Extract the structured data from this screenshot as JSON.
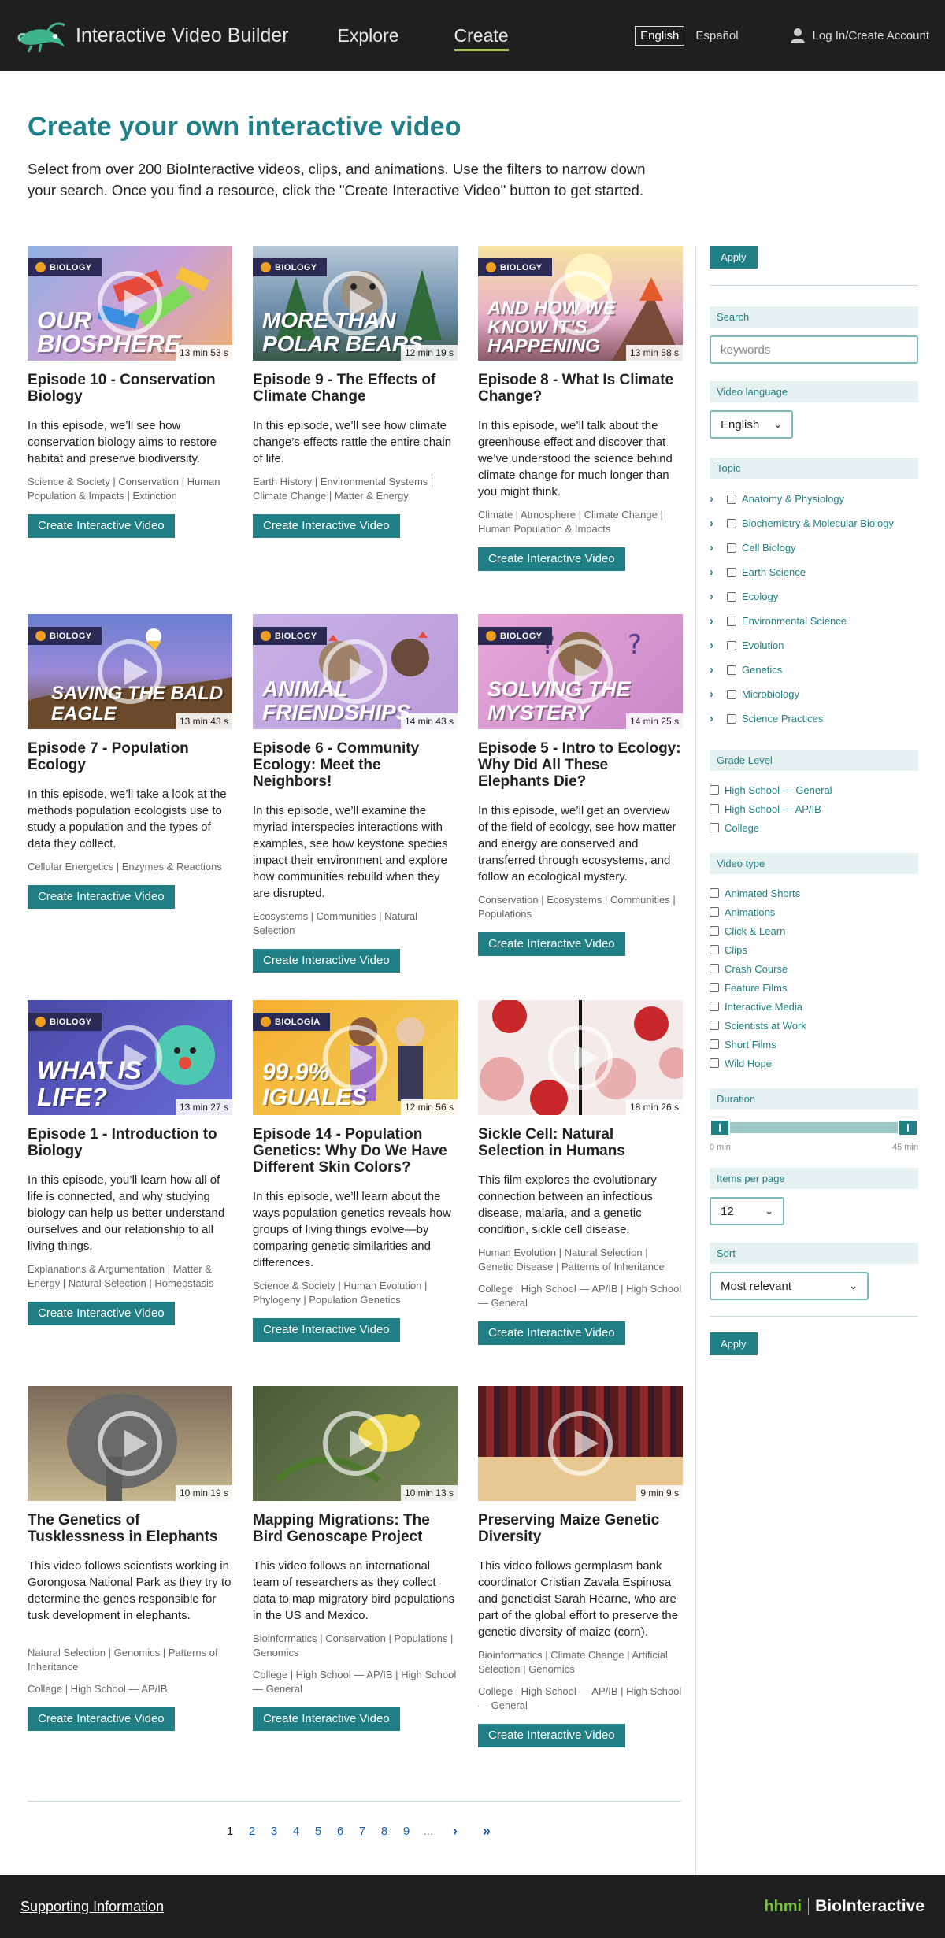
{
  "header": {
    "site_title": "Interactive Video Builder",
    "nav": [
      "Explore",
      "Create"
    ],
    "lang_selected": "English",
    "lang_alt": "Español",
    "login": "Log In/Create Account"
  },
  "intro": {
    "title": "Create your own interactive video",
    "text": "Select from over 200 BioInteractive videos, clips, and animations. Use the filters to narrow down your search. Once you find a resource, click the \"Create Interactive Video\" button to get started."
  },
  "cards": [
    {
      "title": "Episode 10 - Conservation Biology",
      "desc": "In this episode, we’ll see how conservation biology aims to restore habitat and preserve biodiversity.",
      "tags": "Science & Society | Conservation | Human Population & Impacts | Extinction",
      "grades": "",
      "duration": "13 min 53 s",
      "badge": "BIOLOGY",
      "thumb_text": "OUR BIOSPHERE",
      "button": "Create Interactive Video"
    },
    {
      "title": "Episode 9 - The Effects of Climate Change",
      "desc": "In this episode, we’ll see how climate change’s effects rattle the entire chain of life.",
      "tags": "Earth History | Environmental Systems | Climate Change | Matter & Energy",
      "grades": "",
      "duration": "12 min 19 s",
      "badge": "BIOLOGY",
      "thumb_text": "MORE THAN POLAR BEARS",
      "button": "Create Interactive Video"
    },
    {
      "title": "Episode 8 - What Is Climate Change?",
      "desc": "In this episode, we’ll talk about the greenhouse effect and discover that we’ve understood the science behind climate change for much longer than you might think.",
      "tags": "Climate | Atmosphere | Climate Change | Human Population & Impacts",
      "grades": "",
      "duration": "13 min 58 s",
      "badge": "BIOLOGY",
      "thumb_text": "AND HOW WE KNOW IT’S HAPPENING",
      "button": "Create Interactive Video"
    },
    {
      "title": "Episode 7 - Population Ecology",
      "desc": "In this episode, we’ll take a look at the methods population ecologists use to study a population and the types of data they collect.",
      "tags": "Cellular Energetics | Enzymes & Reactions",
      "grades": "",
      "duration": "13 min 43 s",
      "badge": "BIOLOGY",
      "thumb_text": "SAVING THE BALD EAGLE",
      "button": "Create Interactive Video"
    },
    {
      "title": "Episode 6 - Community Ecology: Meet the Neighbors!",
      "desc": "In this episode, we’ll examine the myriad interspecies interactions with examples, see how keystone species impact their environment and explore how communities rebuild when they are disrupted.",
      "tags": "Ecosystems | Communities | Natural Selection",
      "grades": "",
      "duration": "14 min 43 s",
      "badge": "BIOLOGY",
      "thumb_text": "ANIMAL FRIENDSHIPS",
      "button": "Create Interactive Video"
    },
    {
      "title": "Episode 5 - Intro to Ecology: Why Did All These Elephants Die?",
      "desc": "In this episode, we’ll get an overview of the field of ecology, see how matter and energy are conserved and transferred through ecosystems, and follow an ecological mystery.",
      "tags": "Conservation | Ecosystems | Communities | Populations",
      "grades": "",
      "duration": "14 min 25 s",
      "badge": "BIOLOGY",
      "thumb_text": "SOLVING THE MYSTERY",
      "button": "Create Interactive Video"
    },
    {
      "title": "Episode 1 - Introduction to Biology",
      "desc": "In this episode, you’ll learn how all of life is connected, and why studying biology can help us better understand ourselves and our relationship to all living things.",
      "tags": "Explanations & Argumentation | Matter & Energy | Natural Selection | Homeostasis",
      "grades": "",
      "duration": "13 min 27 s",
      "badge": "BIOLOGY",
      "thumb_text": "WHAT IS LIFE?",
      "button": "Create Interactive Video"
    },
    {
      "title": "Episode 14 - Population Genetics: Why Do We Have Different Skin Colors?",
      "desc": "In this episode, we’ll learn about the ways population genetics reveals how groups of living things evolve—by comparing genetic similarities and differences.",
      "tags": "Science & Society | Human Evolution | Phylogeny | Population Genetics",
      "grades": "",
      "duration": "12 min 56 s",
      "badge": "BIOLOGÍA",
      "thumb_text": "99.9% IGUALES",
      "button": "Create Interactive Video"
    },
    {
      "title": "Sickle Cell: Natural Selection in Humans",
      "desc": "This film explores the evolutionary connection between an infectious disease, malaria, and a genetic condition, sickle cell disease.",
      "tags": "Human Evolution | Natural Selection | Genetic Disease | Patterns of Inheritance",
      "grades": "College | High School — AP/IB | High School — General",
      "duration": "18 min 26 s",
      "badge": "",
      "thumb_text": "",
      "button": "Create Interactive Video"
    },
    {
      "title": "The Genetics of Tusklessness in Elephants",
      "desc": "This video follows scientists working in Gorongosa National Park as they try to determine the genes responsible for tusk development in elephants.",
      "tags": "Natural Selection | Genomics | Patterns of Inheritance",
      "grades": "College | High School — AP/IB",
      "duration": "10 min 19 s",
      "badge": "",
      "thumb_text": "",
      "button": "Create Interactive Video"
    },
    {
      "title": "Mapping Migrations: The Bird Genoscape Project",
      "desc": "This video follows an international team of researchers as they collect data to map migratory bird populations in the US and Mexico.",
      "tags": "Bioinformatics | Conservation | Populations | Genomics",
      "grades": "College | High School — AP/IB | High School — General",
      "duration": "10 min 13 s",
      "badge": "",
      "thumb_text": "",
      "button": "Create Interactive Video"
    },
    {
      "title": "Preserving Maize Genetic Diversity",
      "desc": "This video follows germplasm bank coordinator Cristian Zavala Espinosa and geneticist Sarah Hearne, who are part of the global effort to preserve the genetic diversity of maize (corn).",
      "tags": "Bioinformatics | Climate Change | Artificial Selection | Genomics",
      "grades": "College | High School — AP/IB | High School — General",
      "duration": "9 min 9 s",
      "badge": "",
      "thumb_text": "",
      "button": "Create Interactive Video"
    }
  ],
  "pager": {
    "pages": [
      "1",
      "2",
      "3",
      "4",
      "5",
      "6",
      "7",
      "8",
      "9",
      "..."
    ],
    "current": "1",
    "next": "›",
    "last": "»"
  },
  "sidebar": {
    "apply": "Apply",
    "search_head": "Search",
    "search_placeholder": "keywords",
    "language_head": "Video language",
    "language_value": "English",
    "topic_head": "Topic",
    "topics": [
      "Anatomy & Physiology",
      "Biochemistry & Molecular Biology",
      "Cell Biology",
      "Earth Science",
      "Ecology",
      "Environmental Science",
      "Evolution",
      "Genetics",
      "Microbiology",
      "Science Practices"
    ],
    "grade_head": "Grade Level",
    "grades": [
      "High School — General",
      "High School — AP/IB",
      "College"
    ],
    "type_head": "Video type",
    "types": [
      "Animated Shorts",
      "Animations",
      "Click & Learn",
      "Clips",
      "Crash Course",
      "Feature Films",
      "Interactive Media",
      "Scientists at Work",
      "Short Films",
      "Wild Hope"
    ],
    "duration_head": "Duration",
    "duration_min": "0 min",
    "duration_max": "45 min",
    "duration_range_min": 0,
    "duration_range_max": 45,
    "per_page_head": "Items per page",
    "per_page_value": "12",
    "sort_head": "Sort",
    "sort_value": "Most relevant"
  },
  "footer": {
    "link": "Supporting Information",
    "brand_a": "hhmi",
    "brand_b": "BioInteractive"
  },
  "colors": {
    "teal": "#1f7f85",
    "header_bg": "#1f1f1f"
  }
}
